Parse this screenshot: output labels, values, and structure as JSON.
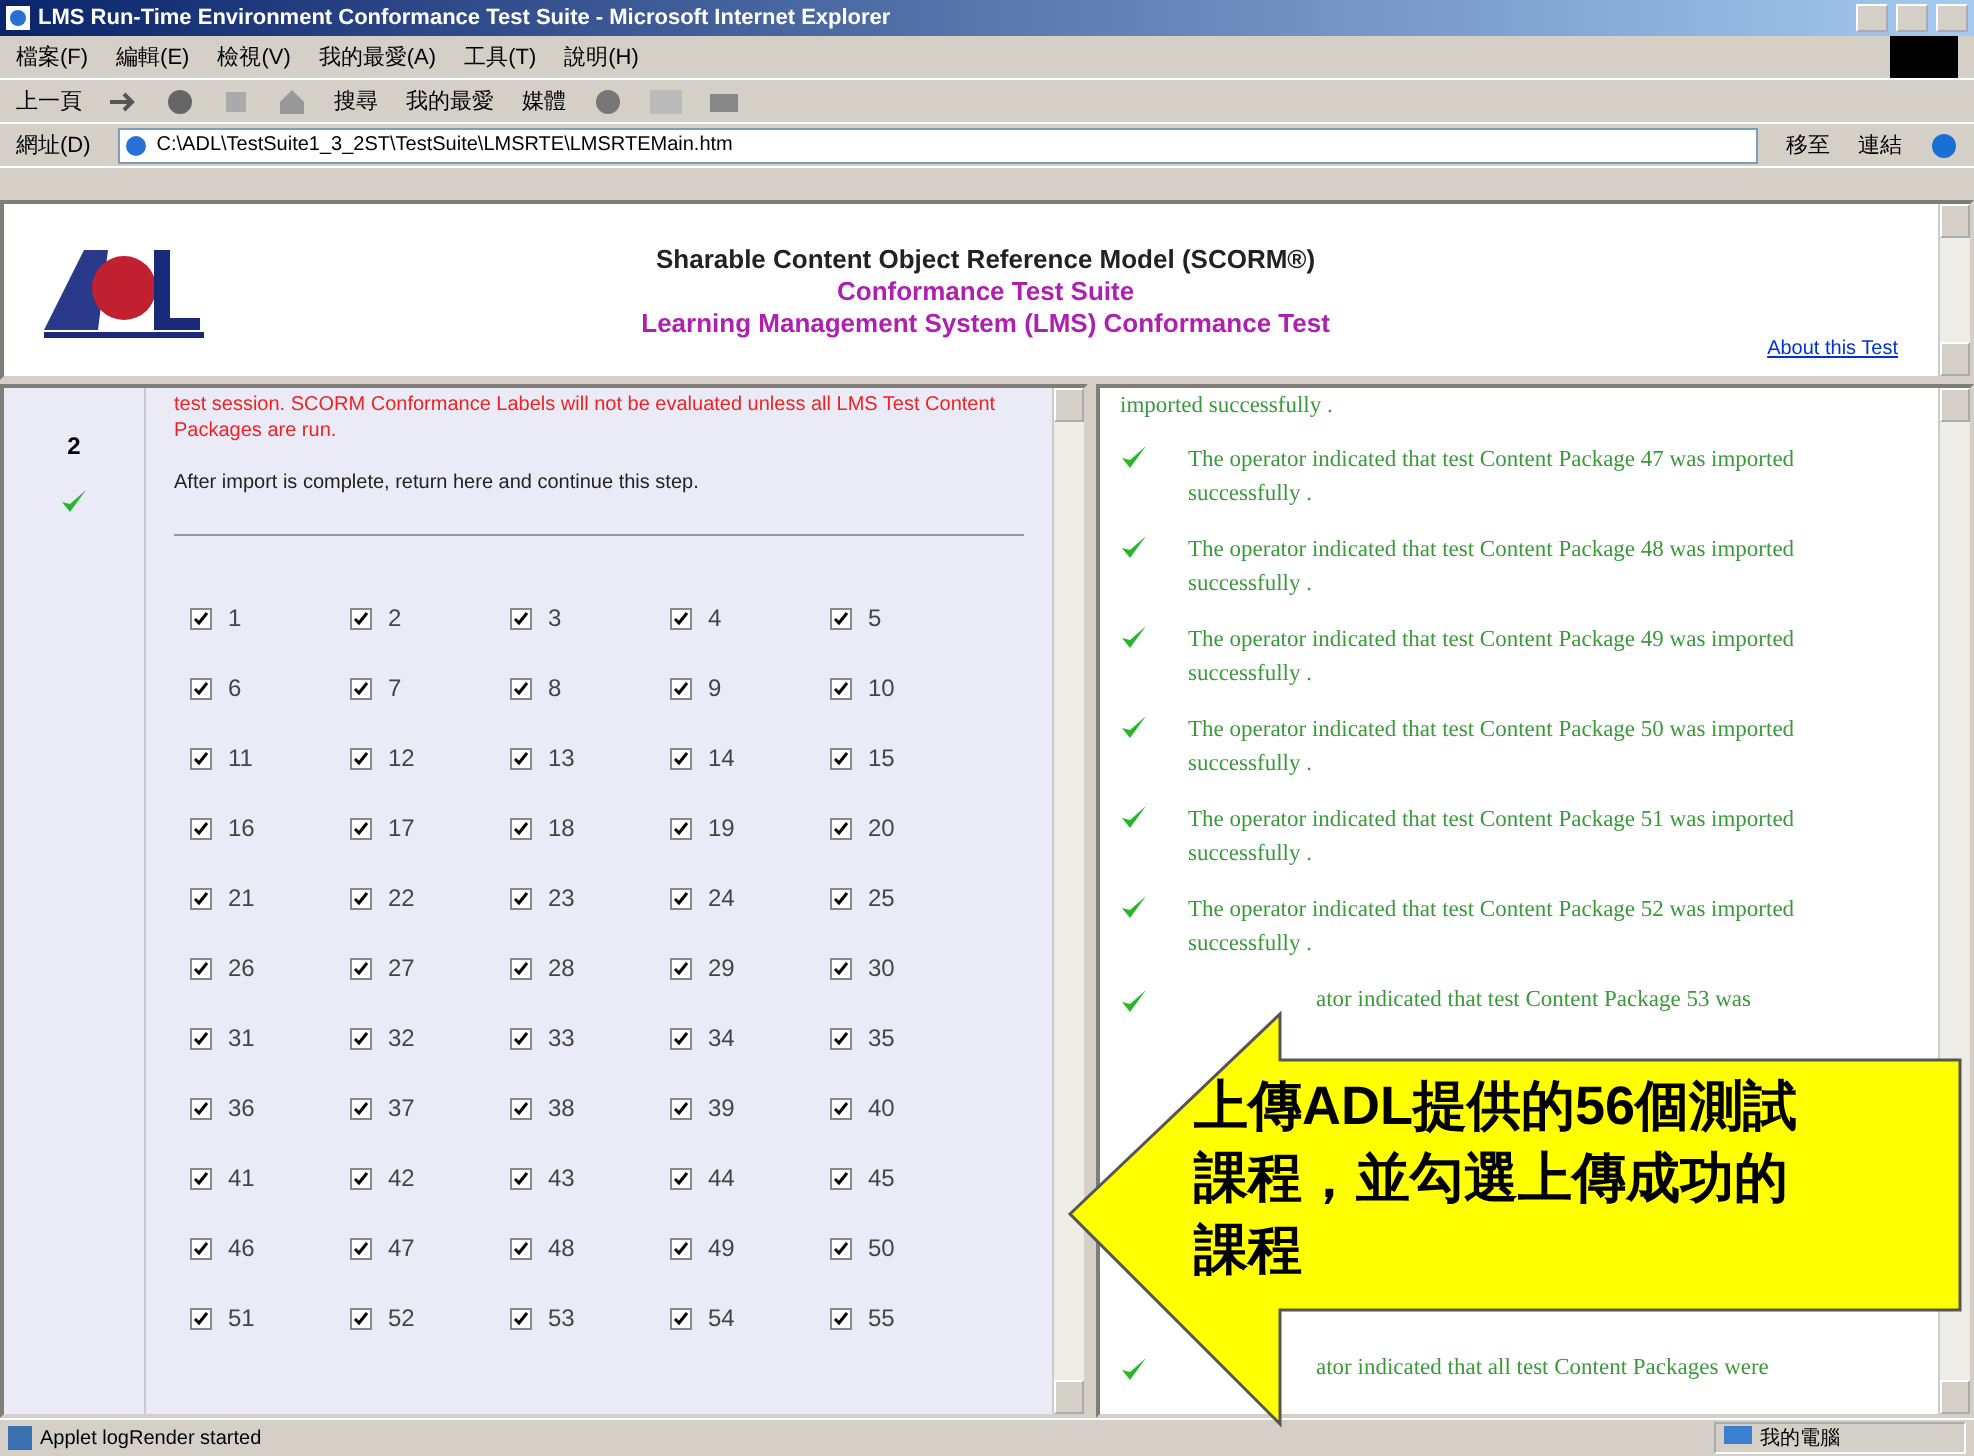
{
  "window": {
    "title": "LMS Run-Time Environment Conformance Test Suite - Microsoft Internet Explorer"
  },
  "menu": [
    "檔案(F)",
    "編輯(E)",
    "檢視(V)",
    "我的最愛(A)",
    "工具(T)",
    "說明(H)"
  ],
  "toolbar": {
    "back": "上一頁",
    "search": "搜尋",
    "favorites": "我的最愛",
    "media": "媒體"
  },
  "address": {
    "label": "網址(D)",
    "value": "C:\\ADL\\TestSuite1_3_2ST\\TestSuite\\LMSRTE\\LMSRTEMain.htm",
    "go": "移至",
    "links": "連結"
  },
  "header": {
    "title": "Sharable Content Object Reference Model (SCORM®)",
    "subtitle": "Conformance Test Suite",
    "test": "Learning Management System (LMS) Conformance Test",
    "link": "About this Test"
  },
  "step": {
    "number": "2",
    "done": true,
    "warning": "test session. SCORM Conformance Labels will not be evaluated unless all LMS Test Content Packages are run.",
    "instruction": "After import is complete, return here and continue this step."
  },
  "packages": [
    {
      "label": "1",
      "checked": true
    },
    {
      "label": "2",
      "checked": true
    },
    {
      "label": "3",
      "checked": true
    },
    {
      "label": "4",
      "checked": true
    },
    {
      "label": "5",
      "checked": true
    },
    {
      "label": "6",
      "checked": true
    },
    {
      "label": "7",
      "checked": true
    },
    {
      "label": "8",
      "checked": true
    },
    {
      "label": "9",
      "checked": true
    },
    {
      "label": "10",
      "checked": true
    },
    {
      "label": "11",
      "checked": true
    },
    {
      "label": "12",
      "checked": true
    },
    {
      "label": "13",
      "checked": true
    },
    {
      "label": "14",
      "checked": true
    },
    {
      "label": "15",
      "checked": true
    },
    {
      "label": "16",
      "checked": true
    },
    {
      "label": "17",
      "checked": true
    },
    {
      "label": "18",
      "checked": true
    },
    {
      "label": "19",
      "checked": true
    },
    {
      "label": "20",
      "checked": true
    },
    {
      "label": "21",
      "checked": true
    },
    {
      "label": "22",
      "checked": true
    },
    {
      "label": "23",
      "checked": true
    },
    {
      "label": "24",
      "checked": true
    },
    {
      "label": "25",
      "checked": true
    },
    {
      "label": "26",
      "checked": true
    },
    {
      "label": "27",
      "checked": true
    },
    {
      "label": "28",
      "checked": true
    },
    {
      "label": "29",
      "checked": true
    },
    {
      "label": "30",
      "checked": true
    },
    {
      "label": "31",
      "checked": true
    },
    {
      "label": "32",
      "checked": true
    },
    {
      "label": "33",
      "checked": true
    },
    {
      "label": "34",
      "checked": true
    },
    {
      "label": "35",
      "checked": true
    },
    {
      "label": "36",
      "checked": true
    },
    {
      "label": "37",
      "checked": true
    },
    {
      "label": "38",
      "checked": true
    },
    {
      "label": "39",
      "checked": true
    },
    {
      "label": "40",
      "checked": true
    },
    {
      "label": "41",
      "checked": true
    },
    {
      "label": "42",
      "checked": true
    },
    {
      "label": "43",
      "checked": true
    },
    {
      "label": "44",
      "checked": true
    },
    {
      "label": "45",
      "checked": true
    },
    {
      "label": "46",
      "checked": true
    },
    {
      "label": "47",
      "checked": true
    },
    {
      "label": "48",
      "checked": true
    },
    {
      "label": "49",
      "checked": true
    },
    {
      "label": "50",
      "checked": true
    },
    {
      "label": "51",
      "checked": true
    },
    {
      "label": "52",
      "checked": true
    },
    {
      "label": "53",
      "checked": true
    },
    {
      "label": "54",
      "checked": true
    },
    {
      "label": "55",
      "checked": true
    }
  ],
  "log": [
    {
      "kind": "fragment",
      "text": "imported successfully ."
    },
    {
      "kind": "entry",
      "text": "The operator indicated that test Content Package 47 was imported successfully ."
    },
    {
      "kind": "entry",
      "text": "The operator indicated that test Content Package 48 was imported successfully ."
    },
    {
      "kind": "entry",
      "text": "The operator indicated that test Content Package 49 was imported successfully ."
    },
    {
      "kind": "entry",
      "text": "The operator indicated that test Content Package 50 was imported successfully ."
    },
    {
      "kind": "entry",
      "text": "The operator indicated that test Content Package 51 was imported successfully ."
    },
    {
      "kind": "entry",
      "text": "The operator indicated that test Content Package 52 was imported successfully ."
    },
    {
      "kind": "partial",
      "text": "ator indicated that test Content Package 53 was"
    },
    {
      "kind": "gap"
    },
    {
      "kind": "partial",
      "text": "ator indicated that all test Content Packages were"
    }
  ],
  "callout": {
    "text": "上傳ADL提供的56個測試課程，並勾選上傳成功的課程"
  },
  "status_bar": {
    "text": "Applet logRender started",
    "zone": "我的電腦"
  }
}
